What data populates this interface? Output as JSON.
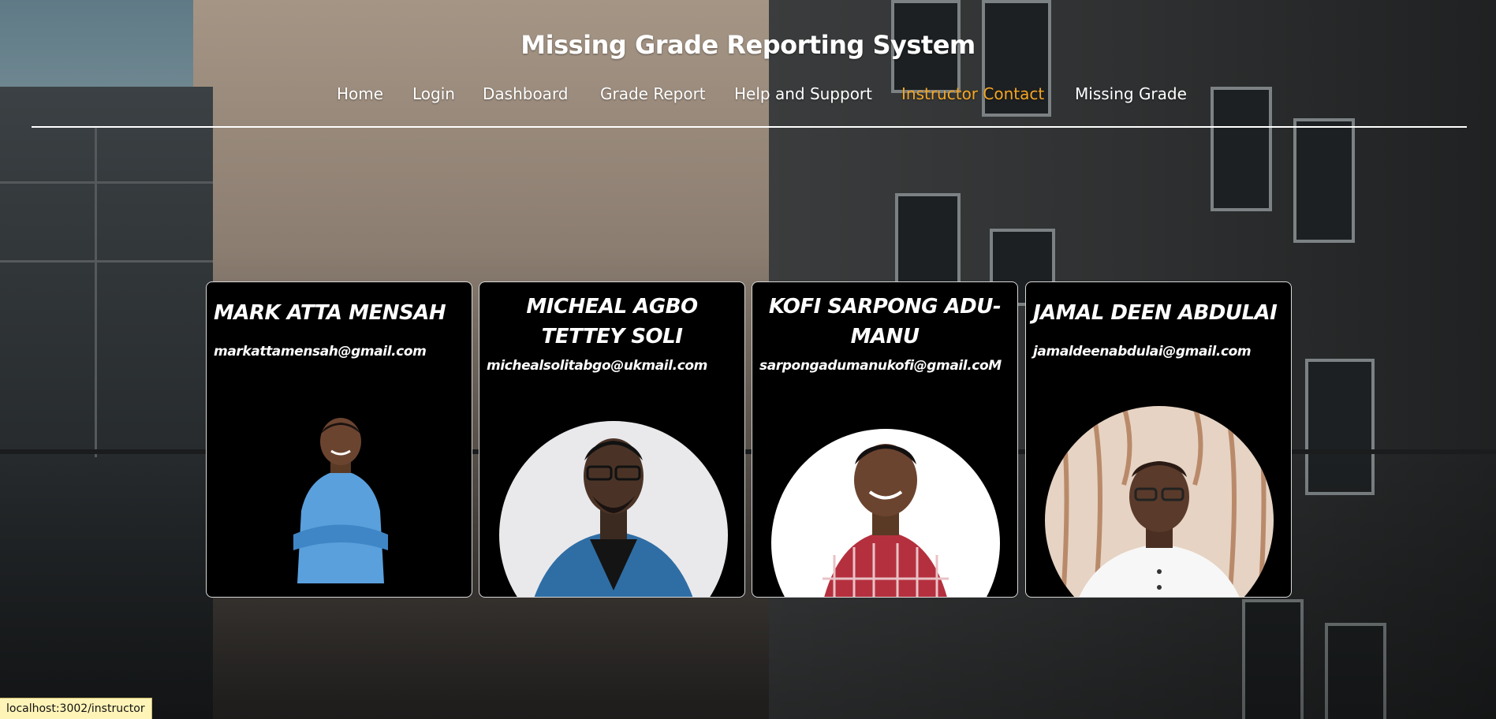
{
  "header": {
    "title": "Missing Grade Reporting System",
    "nav": [
      {
        "label": "Home"
      },
      {
        "label": "Login"
      },
      {
        "label": "Dashboard"
      },
      {
        "label": "Grade Report"
      },
      {
        "label": "Help and Support"
      },
      {
        "label": "Instructor Contact",
        "active": true
      },
      {
        "label": "Missing Grade"
      }
    ],
    "active_color": "#f5a623"
  },
  "instructors": [
    {
      "name": "MARK ATTA MENSAH",
      "email": "markattamensah@gmail.com",
      "photo": "portrait-man-light-blue-shirt"
    },
    {
      "name": "MICHEAL AGBO TETTEY SOLI",
      "email": "michealsolitabgo@ukmail.com",
      "photo": "portrait-man-blue-blazer-glasses"
    },
    {
      "name": "KOFI SARPONG ADU-MANU",
      "email": "sarpongadumanukofi@gmail.coM",
      "photo": "portrait-man-checkered-shirt"
    },
    {
      "name": "JAMAL DEEN ABDULAI",
      "email": "jamaldeenabdulai@gmail.com",
      "photo": "portrait-man-white-shirt-glasses"
    }
  ],
  "status_bar": {
    "url": "localhost:3002/instructor"
  }
}
